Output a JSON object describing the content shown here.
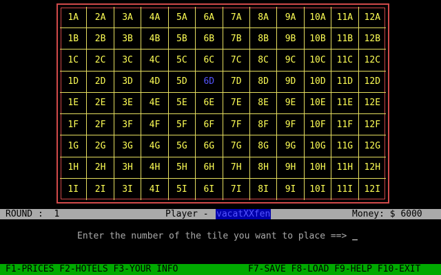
{
  "board": {
    "columns": [
      "1",
      "2",
      "3",
      "4",
      "5",
      "6",
      "7",
      "8",
      "9",
      "10",
      "11",
      "12"
    ],
    "rows": [
      "A",
      "B",
      "C",
      "D",
      "E",
      "F",
      "G",
      "H",
      "I"
    ],
    "highlighted_tile": "6D"
  },
  "status": {
    "round": "ROUND :  1",
    "player_label": "Player -",
    "player_name": "vacatXXfen",
    "money": "Money: $ 6000"
  },
  "prompt": {
    "text": "Enter the number of the tile you want to place ==> ",
    "cursor": "_"
  },
  "function_keys": {
    "left": "F1-PRICES F2-HOTELS F3-YOUR INFO",
    "right": "F7-SAVE F8-LOAD F9-HELP F10-EXIT"
  },
  "colors": {
    "tile_text": "#ffff55",
    "highlight": "#5555ff",
    "board_border": "#d24a4a",
    "status_bar": "#aaaaaa",
    "fkey_bar": "#00aa00"
  }
}
